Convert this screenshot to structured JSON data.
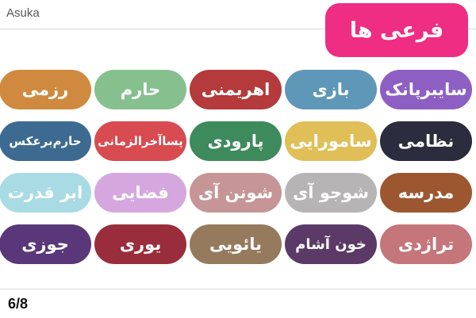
{
  "app": {
    "title": "Asuka"
  },
  "header": {
    "label": "فرعی ها",
    "color": "#ef2d82"
  },
  "tiles": [
    {
      "label": "سایبرپانک",
      "color": "#8e5fc3"
    },
    {
      "label": "بازی",
      "color": "#5e97b8"
    },
    {
      "label": "اهریمنی",
      "color": "#b43a3b"
    },
    {
      "label": "حارم",
      "color": "#86c08f"
    },
    {
      "label": "رزمی",
      "color": "#cf8a3f"
    },
    {
      "label": "نظامی",
      "color": "#2b2d3e"
    },
    {
      "label": "سامورایی",
      "color": "#e0bf58"
    },
    {
      "label": "پارودی",
      "color": "#3d8a5c"
    },
    {
      "label": "پساآخرالزمانی",
      "color": "#d84b50"
    },
    {
      "label": "حارم‌برعکس",
      "color": "#3d6a90"
    },
    {
      "label": "مدرسه",
      "color": "#9c5731"
    },
    {
      "label": "شوجو آی",
      "color": "#b7b4b6"
    },
    {
      "label": "شونن آی",
      "color": "#c69596"
    },
    {
      "label": "فضایی",
      "color": "#d6a7df"
    },
    {
      "label": "ابر قدرت",
      "color": "#a8dbe4"
    },
    {
      "label": "تراژدی",
      "color": "#c4767a"
    },
    {
      "label": "خون آشام",
      "color": "#5b3a67"
    },
    {
      "label": "یائویی",
      "color": "#957a5e"
    },
    {
      "label": "یوری",
      "color": "#9a2d3b"
    },
    {
      "label": "جوزی",
      "color": "#5a3778"
    }
  ],
  "footer": {
    "page": "6/8"
  }
}
